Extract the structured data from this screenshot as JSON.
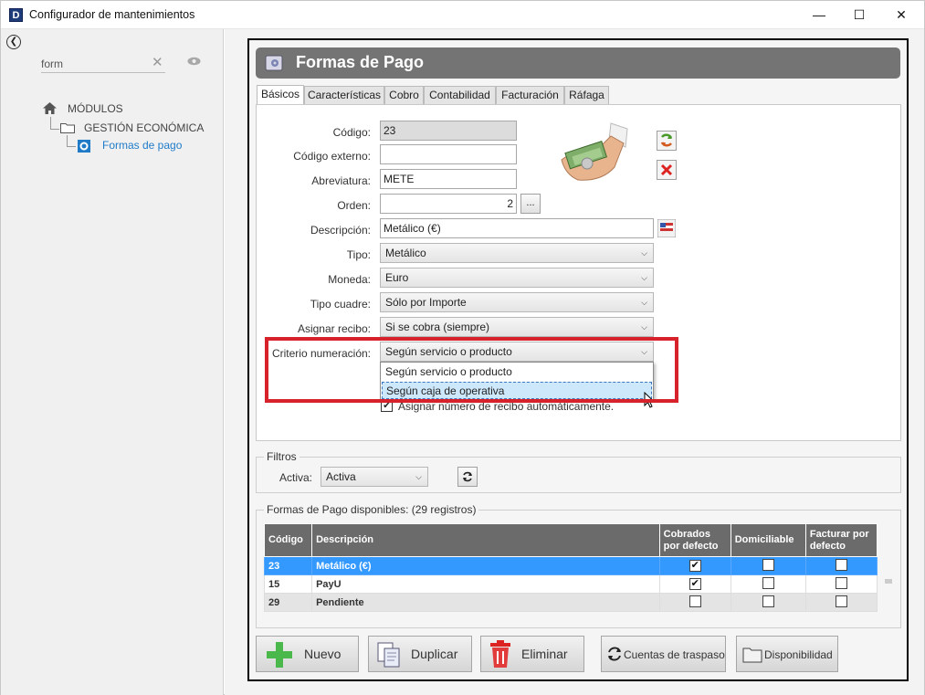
{
  "window": {
    "title": "Configurador de mantenimientos",
    "app_icon_letter": "D",
    "minimize": "—",
    "maximize": "☐",
    "close": "✕"
  },
  "sidebar": {
    "search_value": "form",
    "tree": {
      "root": "MÓDULOS",
      "group": "GESTIÓN ECONÓMICA",
      "item": "Formas de pago"
    }
  },
  "header": {
    "title": "Formas de Pago"
  },
  "tabs": [
    "Básicos",
    "Características",
    "Cobro",
    "Contabilidad",
    "Facturación",
    "Ráfaga"
  ],
  "form": {
    "codigo_label": "Código:",
    "codigo": "23",
    "codigo_externo_label": "Código externo:",
    "codigo_externo": "",
    "abreviatura_label": "Abreviatura:",
    "abreviatura": "METE",
    "orden_label": "Orden:",
    "orden": "2",
    "orden_btn": "...",
    "descripcion_label": "Descripción:",
    "descripcion": "Metálico (€)",
    "tipo_label": "Tipo:",
    "tipo": "Metálico",
    "moneda_label": "Moneda:",
    "moneda": "Euro",
    "tipo_cuadre_label": "Tipo cuadre:",
    "tipo_cuadre": "Sólo por Importe",
    "asignar_recibo_label": "Asignar recibo:",
    "asignar_recibo": "Si se cobra (siempre)",
    "criterio_label": "Criterio numeración:",
    "criterio": "Según servicio o producto",
    "criterio_options": [
      "Según servicio o producto",
      "Según caja de operativa"
    ],
    "auto_recibo_label": "Asignar número de recibo automáticamente."
  },
  "filtros": {
    "title": "Filtros",
    "activa_label": "Activa:",
    "activa": "Activa"
  },
  "table": {
    "title": "Formas de Pago disponibles:  (29 registros)",
    "headers": [
      "Código",
      "Descripción",
      "Cobrados por defecto",
      "Domiciliable",
      "Facturar por defecto"
    ],
    "rows": [
      {
        "codigo": "23",
        "descripcion": "Metálico (€)",
        "cobrados": true,
        "domiciliable": false,
        "facturar": false
      },
      {
        "codigo": "15",
        "descripcion": "PayU",
        "cobrados": true,
        "domiciliable": false,
        "facturar": false
      },
      {
        "codigo": "29",
        "descripcion": "Pendiente",
        "cobrados": false,
        "domiciliable": false,
        "facturar": false
      }
    ]
  },
  "buttons": {
    "nuevo": "Nuevo",
    "duplicar": "Duplicar",
    "eliminar": "Eliminar",
    "cuentas": "Cuentas de traspaso",
    "disponibilidad": "Disponibilidad"
  },
  "colors": {
    "accent": "#3399ff",
    "highlight": "#d8222b",
    "header_bg": "#747474"
  }
}
